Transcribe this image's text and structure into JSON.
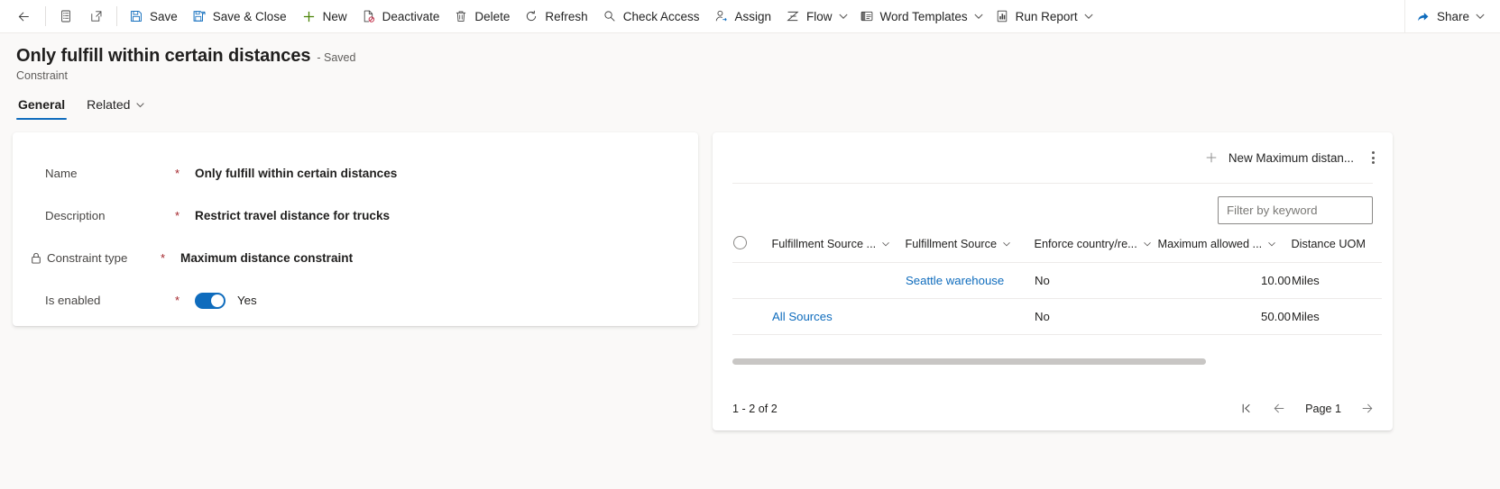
{
  "commandbar": {
    "back_label": "Back",
    "form_selector_label": "Form selector",
    "popout_label": "Open in new window",
    "items": [
      {
        "label": "Save",
        "icon": "save-icon"
      },
      {
        "label": "Save & Close",
        "icon": "save-and-close-icon"
      },
      {
        "label": "New",
        "icon": "plus-icon"
      },
      {
        "label": "Deactivate",
        "icon": "deactivate-icon"
      },
      {
        "label": "Delete",
        "icon": "trash-icon"
      },
      {
        "label": "Refresh",
        "icon": "refresh-icon"
      },
      {
        "label": "Check Access",
        "icon": "key-icon"
      },
      {
        "label": "Assign",
        "icon": "assign-person-icon"
      },
      {
        "label": "Flow",
        "icon": "flow-icon",
        "has_chevron": true
      },
      {
        "label": "Word Templates",
        "icon": "word-template-icon",
        "has_chevron": true
      },
      {
        "label": "Run Report",
        "icon": "report-chart-icon",
        "has_chevron": true
      }
    ],
    "share": {
      "label": "Share",
      "icon": "share-icon",
      "has_chevron": true
    }
  },
  "header": {
    "title": "Only fulfill within certain distances",
    "saved_status": "- Saved",
    "entity": "Constraint"
  },
  "tabs": [
    {
      "label": "General",
      "active": true
    },
    {
      "label": "Related",
      "active": false,
      "has_chevron": true
    }
  ],
  "form": {
    "required_marker": "*",
    "fields": [
      {
        "label": "Name",
        "value": "Only fulfill within certain distances",
        "locked": false
      },
      {
        "label": "Description",
        "value": "Restrict travel distance for trucks",
        "locked": false
      },
      {
        "label": "Constraint type",
        "value": "Maximum distance constraint",
        "locked": true
      },
      {
        "label": "Is enabled",
        "value": "Yes",
        "locked": false,
        "type": "toggle",
        "toggle_on": true
      }
    ]
  },
  "subgrid": {
    "new_button_label": "New Maximum distan...",
    "more_options_label": "More commands",
    "filter_placeholder": "Filter by keyword",
    "filter_value": "",
    "columns": [
      {
        "label": "Fulfillment Source ...",
        "sortable": true
      },
      {
        "label": "Fulfillment Source",
        "sortable": true
      },
      {
        "label": "Enforce country/re...",
        "sortable": true
      },
      {
        "label": "Maximum allowed ...",
        "sortable": true
      },
      {
        "label": "Distance UOM",
        "sortable": false
      }
    ],
    "rows": [
      {
        "fulfillment_source_group": "",
        "fulfillment_source": "Seattle warehouse",
        "enforce_country": "No",
        "maximum_allowed": "10.00",
        "distance_uom": "Miles"
      },
      {
        "fulfillment_source_group": "All Sources",
        "fulfillment_source": "",
        "enforce_country": "No",
        "maximum_allowed": "50.00",
        "distance_uom": "Miles"
      }
    ],
    "record_count_text": "1 - 2 of 2",
    "page_label": "Page 1"
  },
  "colors": {
    "accent": "#0f6cbd",
    "required": "#a4262c",
    "link": "#0f6cbd",
    "new_green": "#498205",
    "page_bg": "#faf9f8"
  }
}
